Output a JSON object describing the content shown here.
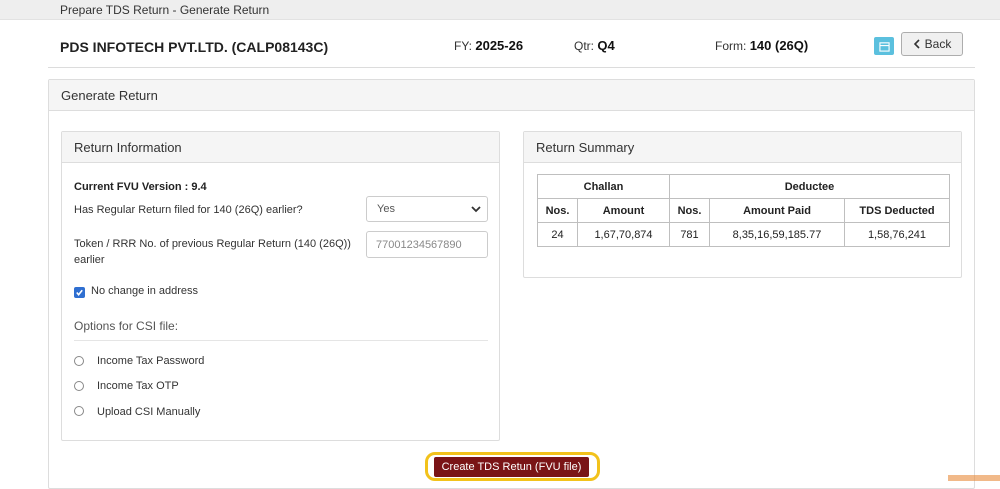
{
  "page": {
    "breadcrumb_title": "Prepare TDS Return - Generate Return"
  },
  "header": {
    "company": "PDS INFOTECH PVT.LTD. (CALP08143C)",
    "fy_label": "FY:",
    "fy_value": "2025-26",
    "qtr_label": "Qtr:",
    "qtr_value": "Q4",
    "form_label": "Form:",
    "form_value": "140 (26Q)",
    "back_label": "Back",
    "calendar_icon": "calendar-icon"
  },
  "generate_panel": {
    "title": "Generate Return"
  },
  "return_info": {
    "title": "Return Information",
    "fvu_version": "Current FVU Version : 9.4",
    "regular_filed_label": "Has Regular Return filed for 140 (26Q) earlier?",
    "regular_filed_value": "Yes",
    "token_label_line1": "Token / RRR No. of previous Regular Return (140 (26Q))",
    "token_label_line2": "earlier",
    "token_value": "77001234567890",
    "no_change_label": "No change in address",
    "no_change_checked": true,
    "csi_title": "Options for CSI file:",
    "csi_options": [
      "Income Tax Password",
      "Income Tax OTP",
      "Upload CSI Manually"
    ]
  },
  "summary": {
    "title": "Return Summary",
    "group_headers": [
      "Challan",
      "Deductee"
    ],
    "columns": [
      "Nos.",
      "Amount",
      "Nos.",
      "Amount Paid",
      "TDS Deducted"
    ],
    "row": [
      "24",
      "1,67,70,874",
      "781",
      "8,35,16,59,185.77",
      "1,58,76,241"
    ]
  },
  "actions": {
    "create_label": "Create TDS Retun (FVU file)"
  },
  "colors": {
    "create_button": "#7a1416",
    "highlight": "#f2c21b",
    "calendar_button": "#5bc0de",
    "checkbox": "#2f6fd1"
  }
}
